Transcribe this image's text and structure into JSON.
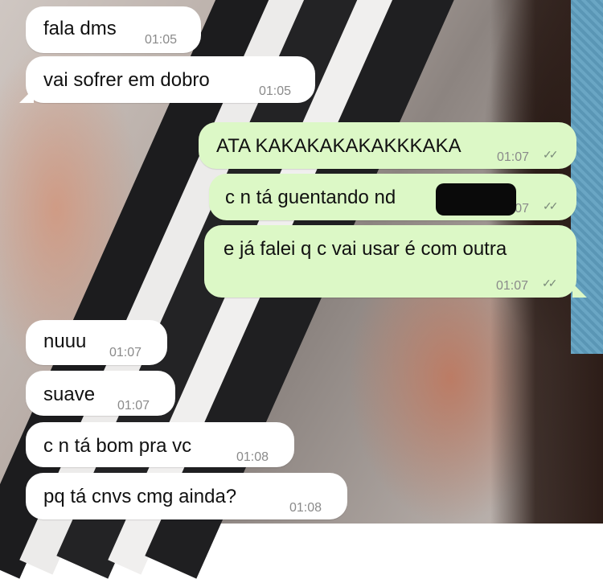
{
  "messages": [
    {
      "text": "fala dms",
      "time": "01:05",
      "dir": "in"
    },
    {
      "text": "vai sofrer em dobro",
      "time": "01:05",
      "dir": "in"
    },
    {
      "text": "ATA KAKAKAKAKAKKKAKA",
      "time": "01:07",
      "dir": "out"
    },
    {
      "text": "c n tá guentando nd",
      "time": "01:07",
      "dir": "out"
    },
    {
      "text": "e já falei q c vai usar é com outra",
      "time": "01:07",
      "dir": "out"
    },
    {
      "text": "nuuu",
      "time": "01:07",
      "dir": "in"
    },
    {
      "text": "suave",
      "time": "01:07",
      "dir": "in"
    },
    {
      "text": "c n tá bom pra vc",
      "time": "01:08",
      "dir": "in"
    },
    {
      "text": "pq tá cnvs cmg ainda?",
      "time": "01:08",
      "dir": "in"
    }
  ],
  "read_receipt_icon": "double-check-icon",
  "colors": {
    "incoming_bubble": "#ffffff",
    "outgoing_bubble": "#dcf8c6",
    "timestamp": "#8a8a8a"
  }
}
